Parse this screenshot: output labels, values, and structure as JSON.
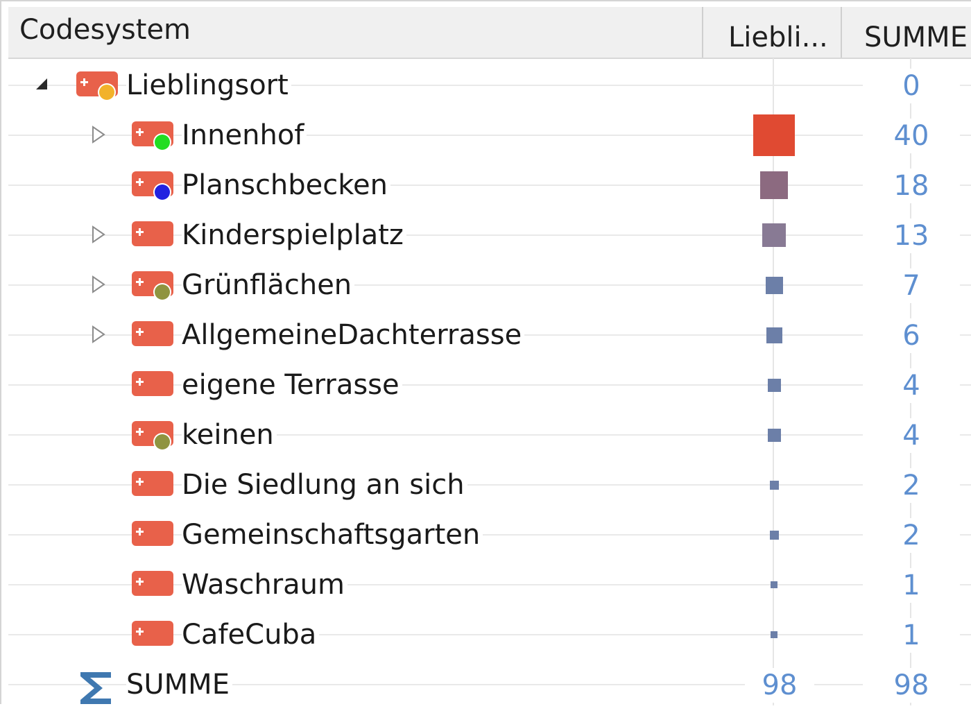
{
  "header": {
    "code_col": "Codesystem",
    "lieb_col": "Liebli...",
    "summe_col": "SUMME"
  },
  "colors": {
    "code_tag": "#e8614a",
    "value_text": "#5e8fd0",
    "guide": "#e6e6e6",
    "header_bg": "#f0f0f0"
  },
  "tree": {
    "root": {
      "label": "Lieblingsort",
      "icon": "tagged-code-icon",
      "dot_color": "#f2b22a",
      "expanded": true,
      "summe": "0",
      "frequency": 0
    },
    "children": [
      {
        "label": "Innenhof",
        "summe": "40",
        "frequency": 40,
        "has_children": true,
        "dot_color": "#22dd22",
        "marker_color": "#e04a32"
      },
      {
        "label": "Planschbecken",
        "summe": "18",
        "frequency": 18,
        "has_children": false,
        "dot_color": "#2222e0",
        "marker_color": "#8c6a80"
      },
      {
        "label": "Kinderspielplatz",
        "summe": "13",
        "frequency": 13,
        "has_children": true,
        "dot_color": null,
        "marker_color": "#887a94"
      },
      {
        "label": "Grünflächen",
        "summe": "7",
        "frequency": 7,
        "has_children": true,
        "dot_color": "#8f9440",
        "marker_color": "#6c7fa8"
      },
      {
        "label": "AllgemeineDachterrasse",
        "summe": "6",
        "frequency": 6,
        "has_children": true,
        "dot_color": null,
        "marker_color": "#6c7fa8"
      },
      {
        "label": "eigene Terrasse",
        "summe": "4",
        "frequency": 4,
        "has_children": false,
        "dot_color": null,
        "marker_color": "#6c7fa8"
      },
      {
        "label": "keinen",
        "summe": "4",
        "frequency": 4,
        "has_children": false,
        "dot_color": "#8f9440",
        "marker_color": "#6c7fa8"
      },
      {
        "label": "Die Siedlung an sich",
        "summe": "2",
        "frequency": 2,
        "has_children": false,
        "dot_color": null,
        "marker_color": "#6c7fa8"
      },
      {
        "label": "Gemeinschaftsgarten",
        "summe": "2",
        "frequency": 2,
        "has_children": false,
        "dot_color": null,
        "marker_color": "#6c7fa8"
      },
      {
        "label": "Waschraum",
        "summe": "1",
        "frequency": 1,
        "has_children": false,
        "dot_color": null,
        "marker_color": "#6c7fa8"
      },
      {
        "label": "CafeCuba",
        "summe": "1",
        "frequency": 1,
        "has_children": false,
        "dot_color": null,
        "marker_color": "#6c7fa8"
      }
    ]
  },
  "total": {
    "icon": "sigma-icon",
    "label": "SUMME",
    "lieb": "98",
    "summe": "98"
  }
}
